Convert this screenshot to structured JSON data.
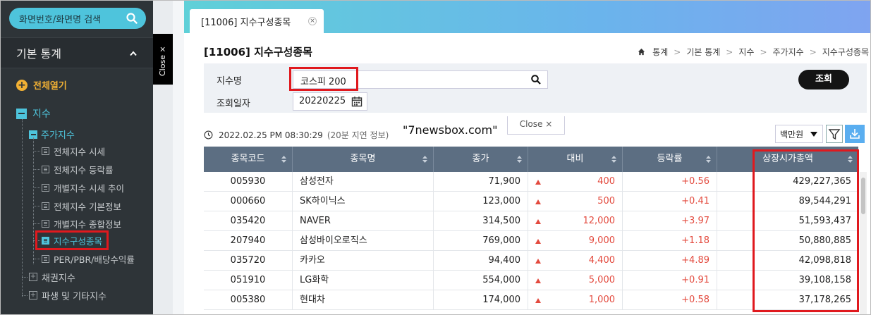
{
  "sidebar": {
    "search_placeholder": "화면번호/화면명 검색",
    "section_title": "기본 통계",
    "expand_all": "전체열기",
    "tree_root": "지수",
    "tree_sub": "주가지수",
    "leaves": [
      "전체지수 시세",
      "전체지수 등락률",
      "개별지수 시세 추이",
      "전체지수 기본정보",
      "개별지수 종합정보",
      "지수구성종목",
      "PER/PBR/배당수익률"
    ],
    "groups": [
      "채권지수",
      "파생 및 기타지수"
    ],
    "close_label": "Close ×"
  },
  "tabs": [
    {
      "label": "[11006] 지수구성종목",
      "close": "×"
    }
  ],
  "page": {
    "title": "[11006] 지수구성종목",
    "breadcrumb": [
      "통계",
      "기본 통계",
      "지수",
      "주가지수",
      "지수구성종목"
    ]
  },
  "filter": {
    "index_label": "지수명",
    "index_value": "코스피 200",
    "date_label": "조회일자",
    "date_value": "20220225",
    "query_button": "조회"
  },
  "toolbar": {
    "timestamp": "2022.02.25 PM 08:30:29",
    "delay_note": "(20분 지연 정보)",
    "watermark": "\"7newsbox.com\"",
    "close_tab": "Close ×",
    "unit": "백만원"
  },
  "table": {
    "columns": [
      "종목코드",
      "종목명",
      "종가",
      "대비",
      "등락률",
      "상장시가총액"
    ],
    "rows": [
      [
        "005930",
        "삼성전자",
        "71,900",
        "400",
        "+0.56",
        "429,227,365"
      ],
      [
        "000660",
        "SK하이닉스",
        "123,000",
        "500",
        "+0.41",
        "89,544,291"
      ],
      [
        "035420",
        "NAVER",
        "314,500",
        "12,000",
        "+3.97",
        "51,593,437"
      ],
      [
        "207940",
        "삼성바이오로직스",
        "769,000",
        "9,000",
        "+1.18",
        "50,880,885"
      ],
      [
        "035720",
        "카카오",
        "94,400",
        "4,400",
        "+4.89",
        "42,098,818"
      ],
      [
        "051910",
        "LG화학",
        "554,000",
        "5,000",
        "+0.91",
        "39,108,158"
      ],
      [
        "005380",
        "현대차",
        "174,000",
        "1,000",
        "+0.58",
        "37,178,265"
      ]
    ]
  },
  "colors": {
    "accent": "#4ec4dc",
    "up": "#e34a3e",
    "highlight": "#e0191e",
    "header": "#5c6e82"
  }
}
